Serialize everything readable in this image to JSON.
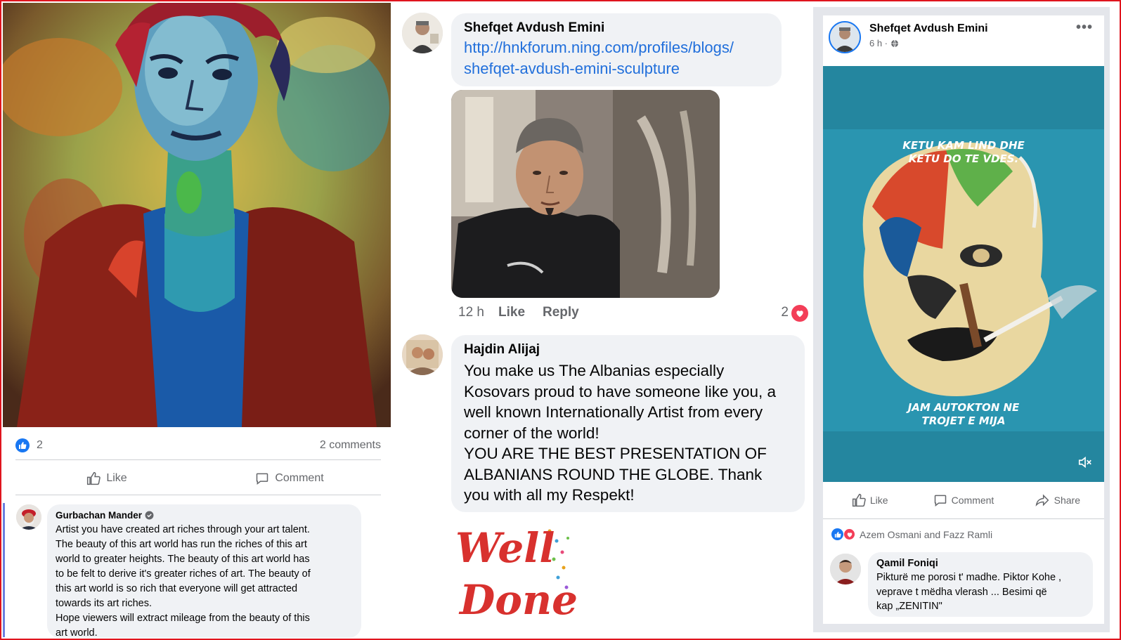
{
  "left_post": {
    "reaction_count": "2",
    "comments_count": "2 comments",
    "like_label": "Like",
    "comment_label": "Comment",
    "comment": {
      "author": "Gurbachan Mander",
      "text": "Artist you have created art riches through your art talent.\nThe beauty of this art world has run the riches of this art\nworld to greater heights. The beauty of this art world has\nto be felt to derive it's greater riches of art. The beauty of\nthis art world is so rich that everyone will get attracted\ntowards its art riches.\nHope viewers will extract mileage from the beauty of this\nart world."
    }
  },
  "middle_thread": {
    "comment1": {
      "author": "Shefqet Avdush Emini",
      "link_line1": "http://hnkforum.ning.com/profiles/blogs/",
      "link_line2": "shefqet-avdush-emini-sculpture"
    },
    "meta": {
      "time": "12 h",
      "like": "Like",
      "reply": "Reply",
      "reaction_count": "2"
    },
    "comment2": {
      "author": "Hajdin Alijaj",
      "text": "You make us The Albanias especially\nKosovars proud to have someone like you, a\nwell known Internationally Artist from every\ncorner of the world!\nYOU ARE THE BEST PRESENTATION OF\nALBANIANS ROUND THE GLOBE. Thank\nyou with all my Respekt!"
    },
    "sticker": {
      "line1": "Well",
      "line2": "Done"
    }
  },
  "right_post": {
    "author": "Shefqet Avdush Emini",
    "time": "6 h ·",
    "more": "•••",
    "video_caption_top_1": "KETU KAM LIND DHE",
    "video_caption_top_2": "KETU DO TE VDES.",
    "video_caption_bottom_1": "JAM AUTOKTON NE",
    "video_caption_bottom_2": "TROJET E MIJA",
    "like_label": "Like",
    "comment_label": "Comment",
    "share_label": "Share",
    "reactors": "Azem Osmani and Fazz Ramli",
    "comment": {
      "author": "Qamil Foniqi",
      "text": "Pikturë me porosi t' madhe. Piktor Kohe ,\nveprave t mëdha vlerash ... Besimi që\nkap „ZENITIN\""
    }
  },
  "colors": {
    "frame": "#e0141e",
    "facebook_blue": "#1877f2",
    "link_blue": "#216fdb",
    "bubble_bg": "#f0f2f5",
    "heart_red": "#f33e58",
    "video_teal": "#24869f"
  },
  "icons": [
    "like-icon",
    "comment-icon",
    "share-icon",
    "globe-icon",
    "mute-icon",
    "verified-icon",
    "heart-icon",
    "more-icon"
  ]
}
